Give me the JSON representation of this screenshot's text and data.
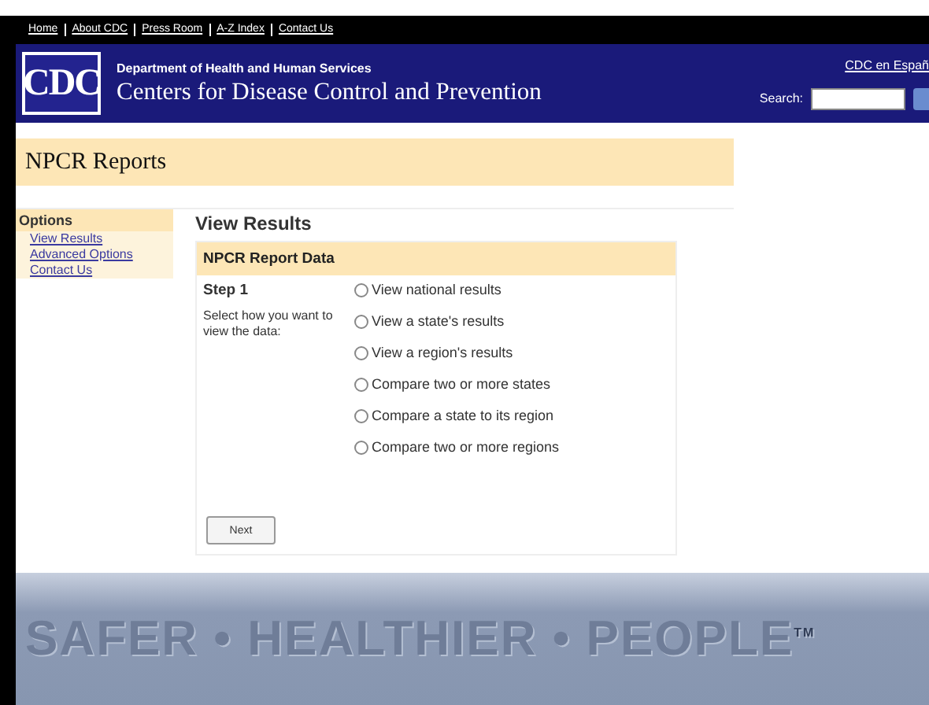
{
  "top_links": [
    "Home",
    "About CDC",
    "Press Room",
    "A-Z Index",
    "Contact Us"
  ],
  "header": {
    "logo": "CDC",
    "department": "Department of Health and Human Services",
    "agency": "Centers for Disease Control and Prevention",
    "spanish_link": "CDC en Españ",
    "search_label": "Search:"
  },
  "page_title": "NPCR Reports",
  "sidebar": {
    "heading": "Options",
    "items": [
      "View Results",
      "Advanced Options",
      "Contact Us"
    ]
  },
  "content": {
    "heading": "View Results",
    "panel_title": "NPCR Report Data",
    "step": "Step 1",
    "instruction": "Select how you want to view the data:",
    "options": [
      {
        "label": "View national results",
        "selected": false
      },
      {
        "label": "View a state's results",
        "selected": false
      },
      {
        "label": "View a region's results",
        "selected": false
      },
      {
        "label": "Compare two or more states",
        "selected": false
      },
      {
        "label": "Compare a state to its region",
        "selected": false
      },
      {
        "label": "Compare two or more regions",
        "selected": false
      }
    ],
    "button": "Next"
  },
  "footer": {
    "slogan": "SAFER • HEALTHIER • PEOPLE",
    "trademark": "TM"
  }
}
